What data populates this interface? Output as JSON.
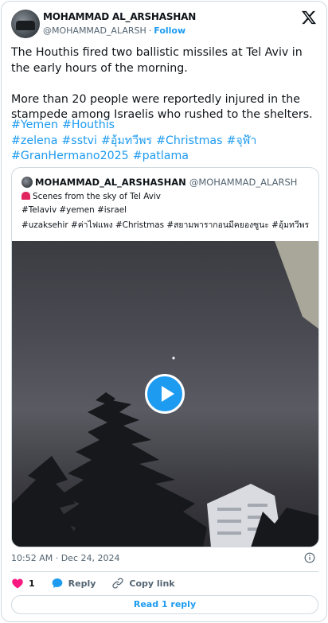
{
  "author": {
    "name": "MOHAMMAD AL_ARSHASHAN",
    "handle": "@MOHAMMAD_ALARSH",
    "separator": "·",
    "follow_label": "Follow"
  },
  "tweet": {
    "text": "The Houthis fired two ballistic missiles at Tel Aviv in the early hours of the morning.\n\nMore than 20 people were reportedly injured in the stampede among Israelis who rushed to the shelters.",
    "hashtags_line1": [
      "#Yemen",
      "#Houthis"
    ],
    "hashtags_line2": [
      "#zelena",
      "#sstvi",
      "#อุ้มทวีพร",
      "#Christmas",
      "#จุฬ้า"
    ],
    "hashtags_line3": [
      "#GranHermano2025",
      "#patlama"
    ]
  },
  "quoted": {
    "name": "MOHAMMAD_AL_ARSHASHAN",
    "handle": "@MOHAMMAD_ALARSH",
    "line1": "Scenes from the sky of Tel Aviv",
    "line2": "#Telaviv #yemen #israel",
    "line3": "#uzaksehir #ค่าไฟแพง #Christmas #สยามพารากอนมีคยองซูนะ #อุ้มทวีพร"
  },
  "footer": {
    "timestamp": "10:52 AM · Dec 24, 2024",
    "like_count": "1",
    "reply_label": "Reply",
    "copy_link_label": "Copy link",
    "read_replies_label": "Read 1 reply"
  },
  "colors": {
    "accent": "#1d9bf0",
    "like": "#f91880",
    "muted": "#536471",
    "border": "#cfd9de"
  },
  "icons": [
    "x-logo-icon",
    "play-icon",
    "info-icon",
    "heart-icon",
    "reply-icon",
    "link-icon",
    "siren-icon"
  ]
}
